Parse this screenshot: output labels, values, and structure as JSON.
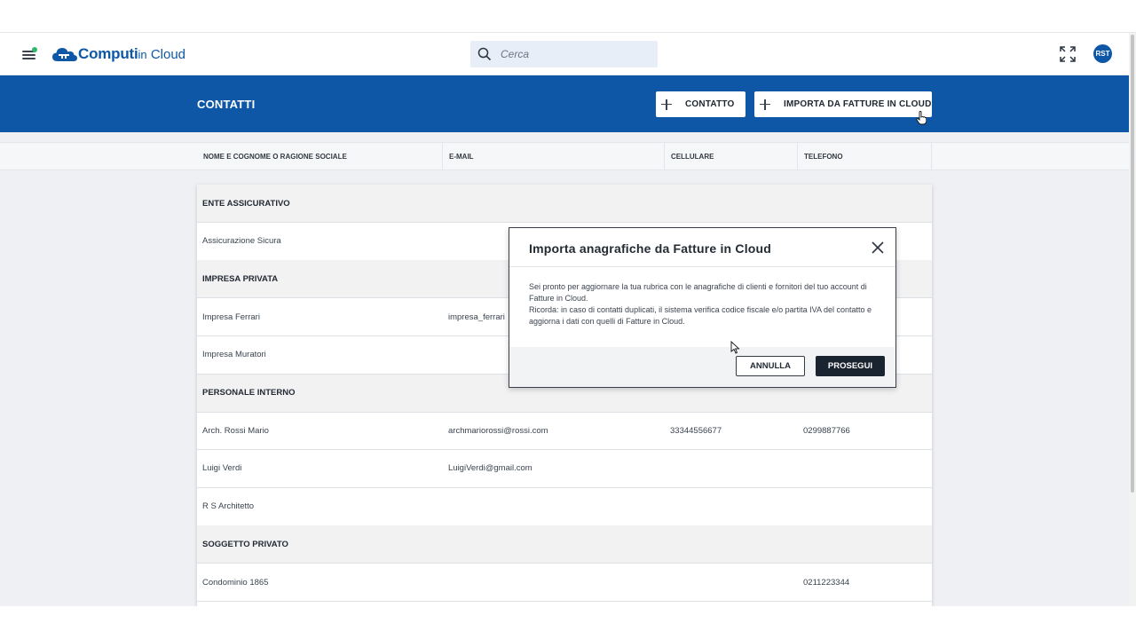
{
  "header": {
    "brand_bold": "Computi",
    "brand_in": "in",
    "brand_light": " Cloud",
    "search_placeholder": "Cerca",
    "avatar_initials": "RST"
  },
  "band": {
    "title": "CONTATTI",
    "add_contact_label": "CONTATTO",
    "import_label": "IMPORTA DA FATTURE IN CLOUD"
  },
  "columns": [
    "NOME E COGNOME O RAGIONE SOCIALE",
    "E-MAIL",
    "CELLULARE",
    "TELEFONO"
  ],
  "rows": [
    {
      "type": "group",
      "name": "ENTE ASSICURATIVO"
    },
    {
      "type": "contact",
      "name": "Assicurazione Sicura",
      "email": "",
      "mobile": "",
      "phone": ""
    },
    {
      "type": "group",
      "name": "IMPRESA PRIVATA"
    },
    {
      "type": "contact",
      "name": "Impresa Ferrari",
      "email": "impresa_ferrari",
      "mobile": "",
      "phone": ""
    },
    {
      "type": "contact",
      "name": "Impresa Muratori",
      "email": "",
      "mobile": "",
      "phone": ""
    },
    {
      "type": "group",
      "name": "PERSONALE INTERNO"
    },
    {
      "type": "contact",
      "name": "Arch. Rossi Mario",
      "email": "archmariorossi@rossi.com",
      "mobile": "33344556677",
      "phone": "0299887766"
    },
    {
      "type": "contact",
      "name": "Luigi Verdi",
      "email": "LuigiVerdi@gmail.com",
      "mobile": "",
      "phone": ""
    },
    {
      "type": "contact",
      "name": "R S Architetto",
      "email": "",
      "mobile": "",
      "phone": ""
    },
    {
      "type": "group",
      "name": "SOGGETTO PRIVATO"
    },
    {
      "type": "contact",
      "name": "Condominio 1865",
      "email": "",
      "mobile": "",
      "phone": "0211223344"
    }
  ],
  "modal": {
    "title": "Importa anagrafiche da Fatture in Cloud",
    "body_line1": "Sei pronto per aggiornare la tua rubrica con le anagrafiche di clienti e fornitori del tuo account di Fatture in Cloud.",
    "body_line2": "Ricorda: in caso di contatti duplicati, il sistema verifica codice fiscale e/o partita IVA del contatto e aggiorna i dati con quelli di Fatture in Cloud.",
    "cancel_label": "ANNULLA",
    "continue_label": "PROSEGUI"
  },
  "colors": {
    "brand_blue": "#0d57a6",
    "dark_button": "#1a2330",
    "status_dot": "#2fb86b"
  },
  "icons": [
    "menu-icon",
    "cloud-logo-icon",
    "search-icon",
    "fullscreen-icon",
    "plus-icon",
    "close-icon"
  ]
}
